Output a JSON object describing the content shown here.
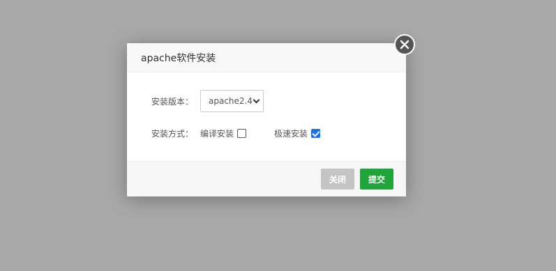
{
  "dialog": {
    "title": "apache软件安装",
    "version_label": "安装版本：",
    "version_value": "apache2.4",
    "mode_label": "安装方式：",
    "mode_options": [
      {
        "label": "编译安装",
        "checked": false
      },
      {
        "label": "极速安装",
        "checked": true
      }
    ],
    "close_label": "关闭",
    "submit_label": "提交"
  },
  "colors": {
    "overlay": "#a8a8a8",
    "submit": "#20a53a",
    "close": "#c4c4c4",
    "checkbox_checked": "#1a73e8"
  }
}
